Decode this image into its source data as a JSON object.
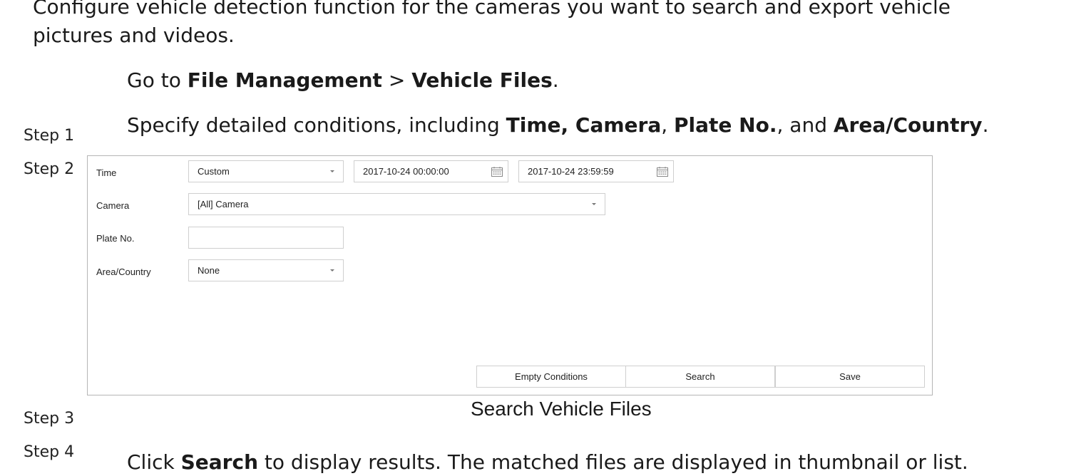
{
  "intro": {
    "line1": "Configure vehicle detection function for the cameras you want to search and export vehicle",
    "line2": "pictures and videos."
  },
  "step1_text": {
    "prefix": "Go to ",
    "menu": "File Management",
    "sep": " > ",
    "item": "Vehicle Files",
    "suffix": "."
  },
  "step2_text": {
    "prefix": "Specify detailed conditions, including ",
    "bold1": "Time, Camera",
    "comma1": ", ",
    "bold2": "Plate No.",
    "mid": ", and ",
    "bold3": "Area/Country",
    "suffix": "."
  },
  "step_labels": [
    "Step 1",
    "Step 2",
    "Step 3",
    "Step 4"
  ],
  "form": {
    "time_label": "Time",
    "time_mode": "Custom",
    "start_time": "2017-10-24 00:00:00",
    "end_time": "2017-10-24 23:59:59",
    "camera_label": "Camera",
    "camera_value": "[All] Camera",
    "plate_label": "Plate No.",
    "plate_value": "",
    "area_label": "Area/Country",
    "area_value": "None",
    "buttons": {
      "empty": "Empty Conditions",
      "search": "Search",
      "save": "Save"
    }
  },
  "figure_caption": "Search Vehicle Files",
  "step4_text": {
    "prefix": "Click ",
    "bold": "Search",
    "suffix": " to display results. The matched files are displayed in thumbnail or list."
  }
}
